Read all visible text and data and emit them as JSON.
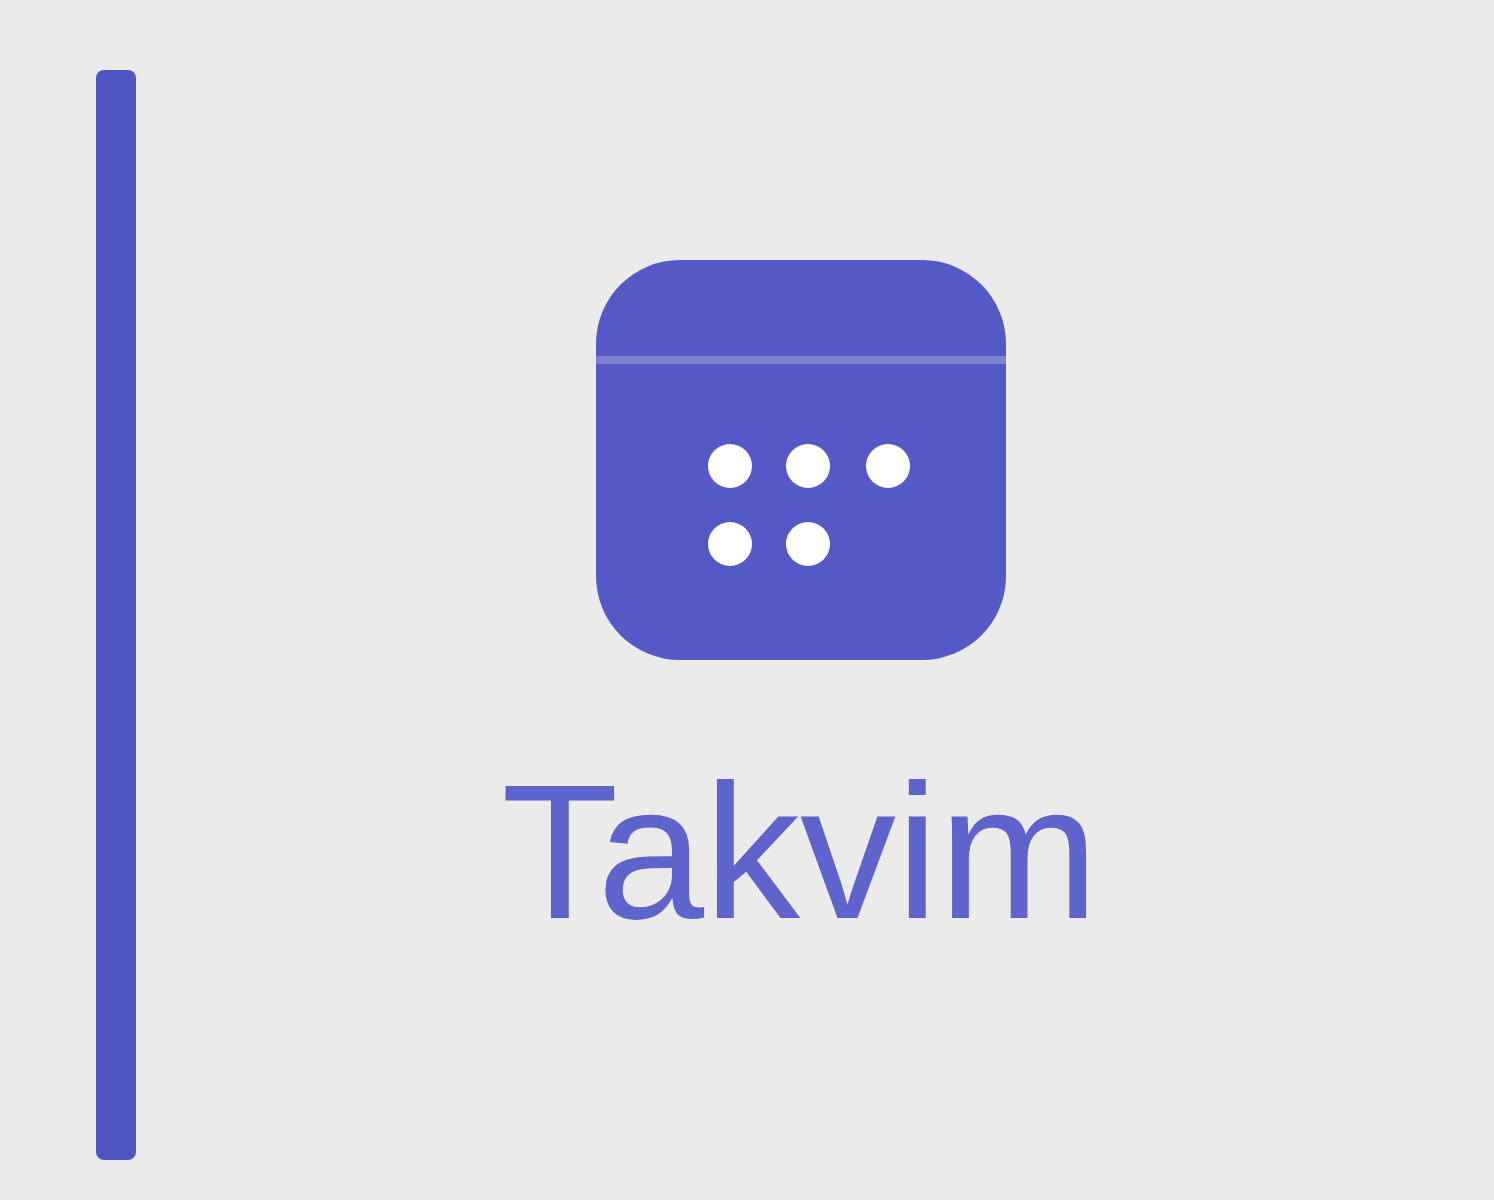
{
  "nav_item": {
    "label": "Takvim",
    "selected": true
  }
}
